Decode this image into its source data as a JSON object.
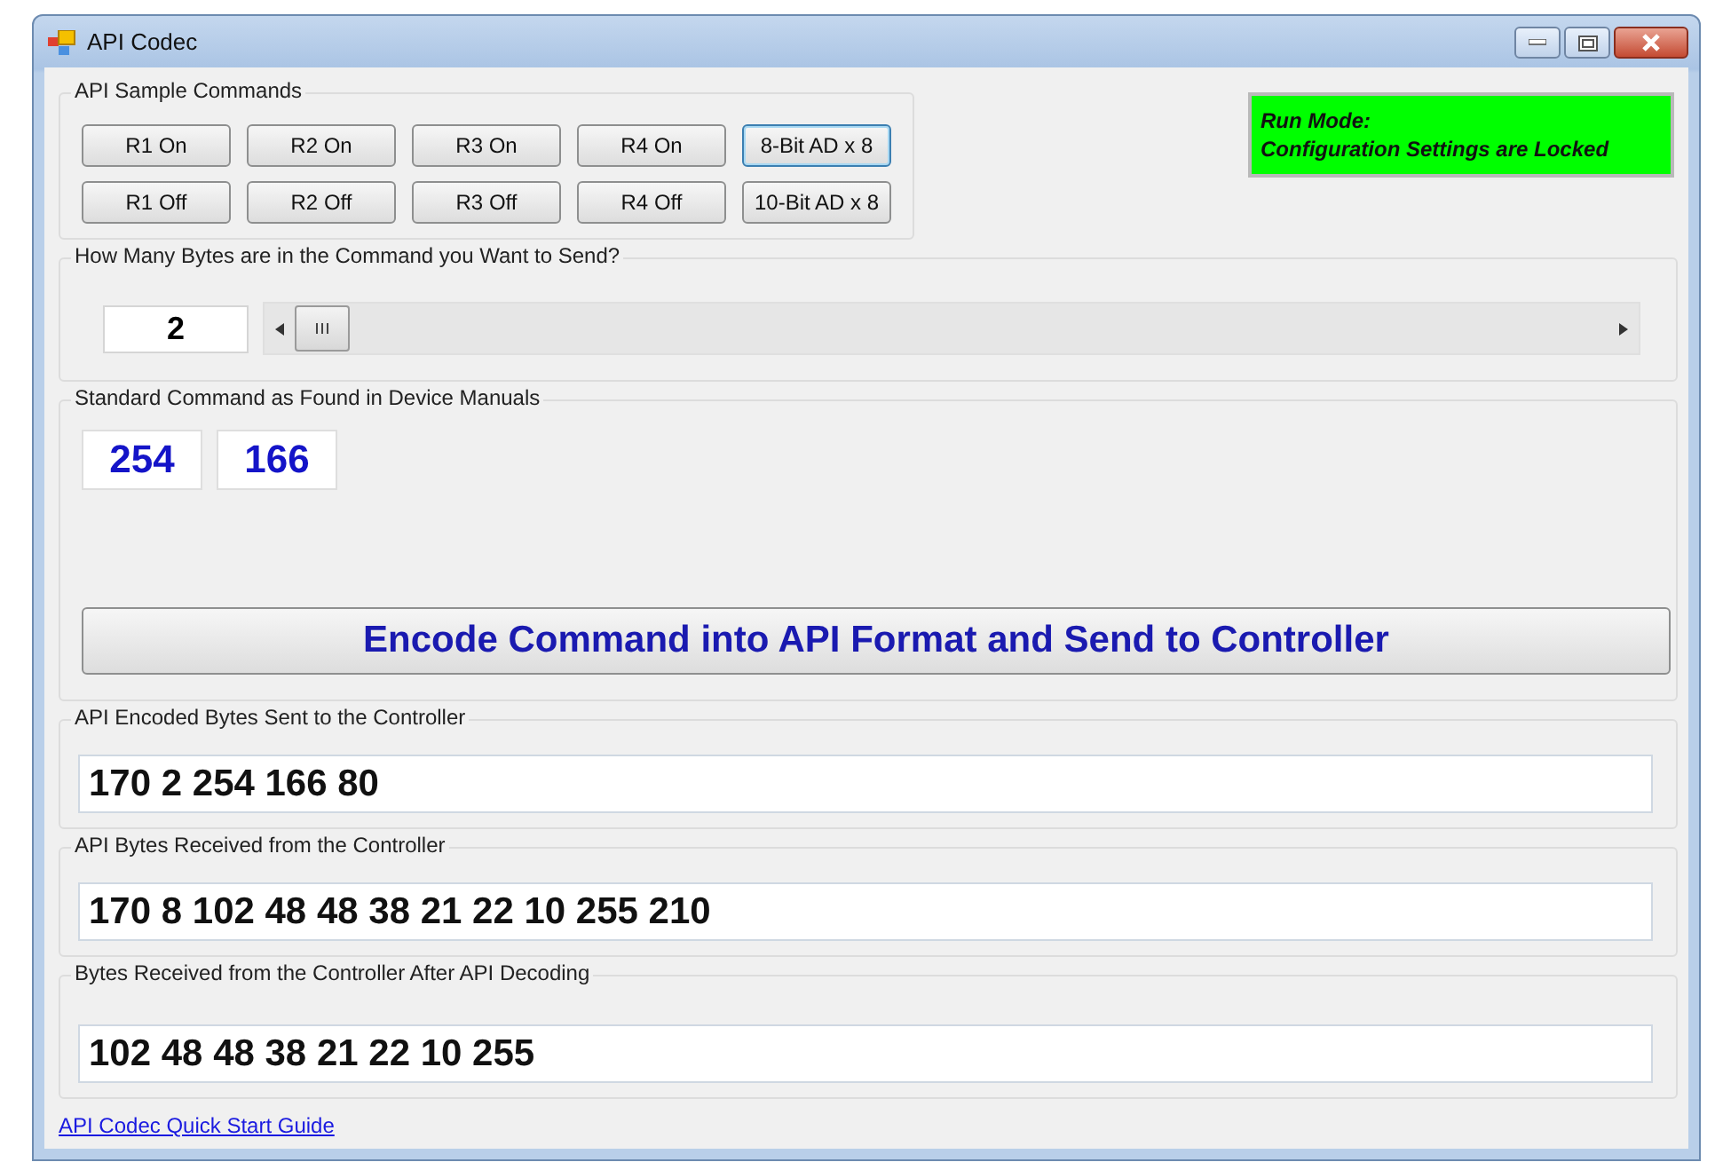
{
  "window": {
    "title": "API Codec"
  },
  "sample_commands": {
    "title": "API Sample Commands",
    "buttons": [
      {
        "label": "R1 On",
        "focused": false
      },
      {
        "label": "R2 On",
        "focused": false
      },
      {
        "label": "R3 On",
        "focused": false
      },
      {
        "label": "R4 On",
        "focused": false
      },
      {
        "label": "8-Bit AD x 8",
        "focused": true
      },
      {
        "label": "R1 Off",
        "focused": false
      },
      {
        "label": "R2 Off",
        "focused": false
      },
      {
        "label": "R3 Off",
        "focused": false
      },
      {
        "label": "R4 Off",
        "focused": false
      },
      {
        "label": "10-Bit AD x 8",
        "focused": false
      }
    ]
  },
  "status": {
    "lines": [
      "Run Mode:",
      "Configuration Settings are Locked"
    ],
    "color": "#00ff00"
  },
  "byte_count": {
    "title": "How Many Bytes are in the Command you Want to Send?",
    "value": "2"
  },
  "standard_command": {
    "title": "Standard Command as Found in Device Manuals",
    "bytes": [
      "254",
      "166"
    ],
    "send_button": "Encode Command into API Format and Send to Controller"
  },
  "outputs": [
    {
      "title": "API Encoded Bytes Sent to the Controller",
      "value": "170 2 254 166 80"
    },
    {
      "title": "API Bytes Received from the Controller",
      "value": "170 8 102 48 48 38 21 22 10 255 210"
    },
    {
      "title": "Bytes Received from the Controller After API Decoding",
      "value": "102 48 48 38 21 22 10 255"
    }
  ],
  "link": "API Codec Quick Start Guide"
}
